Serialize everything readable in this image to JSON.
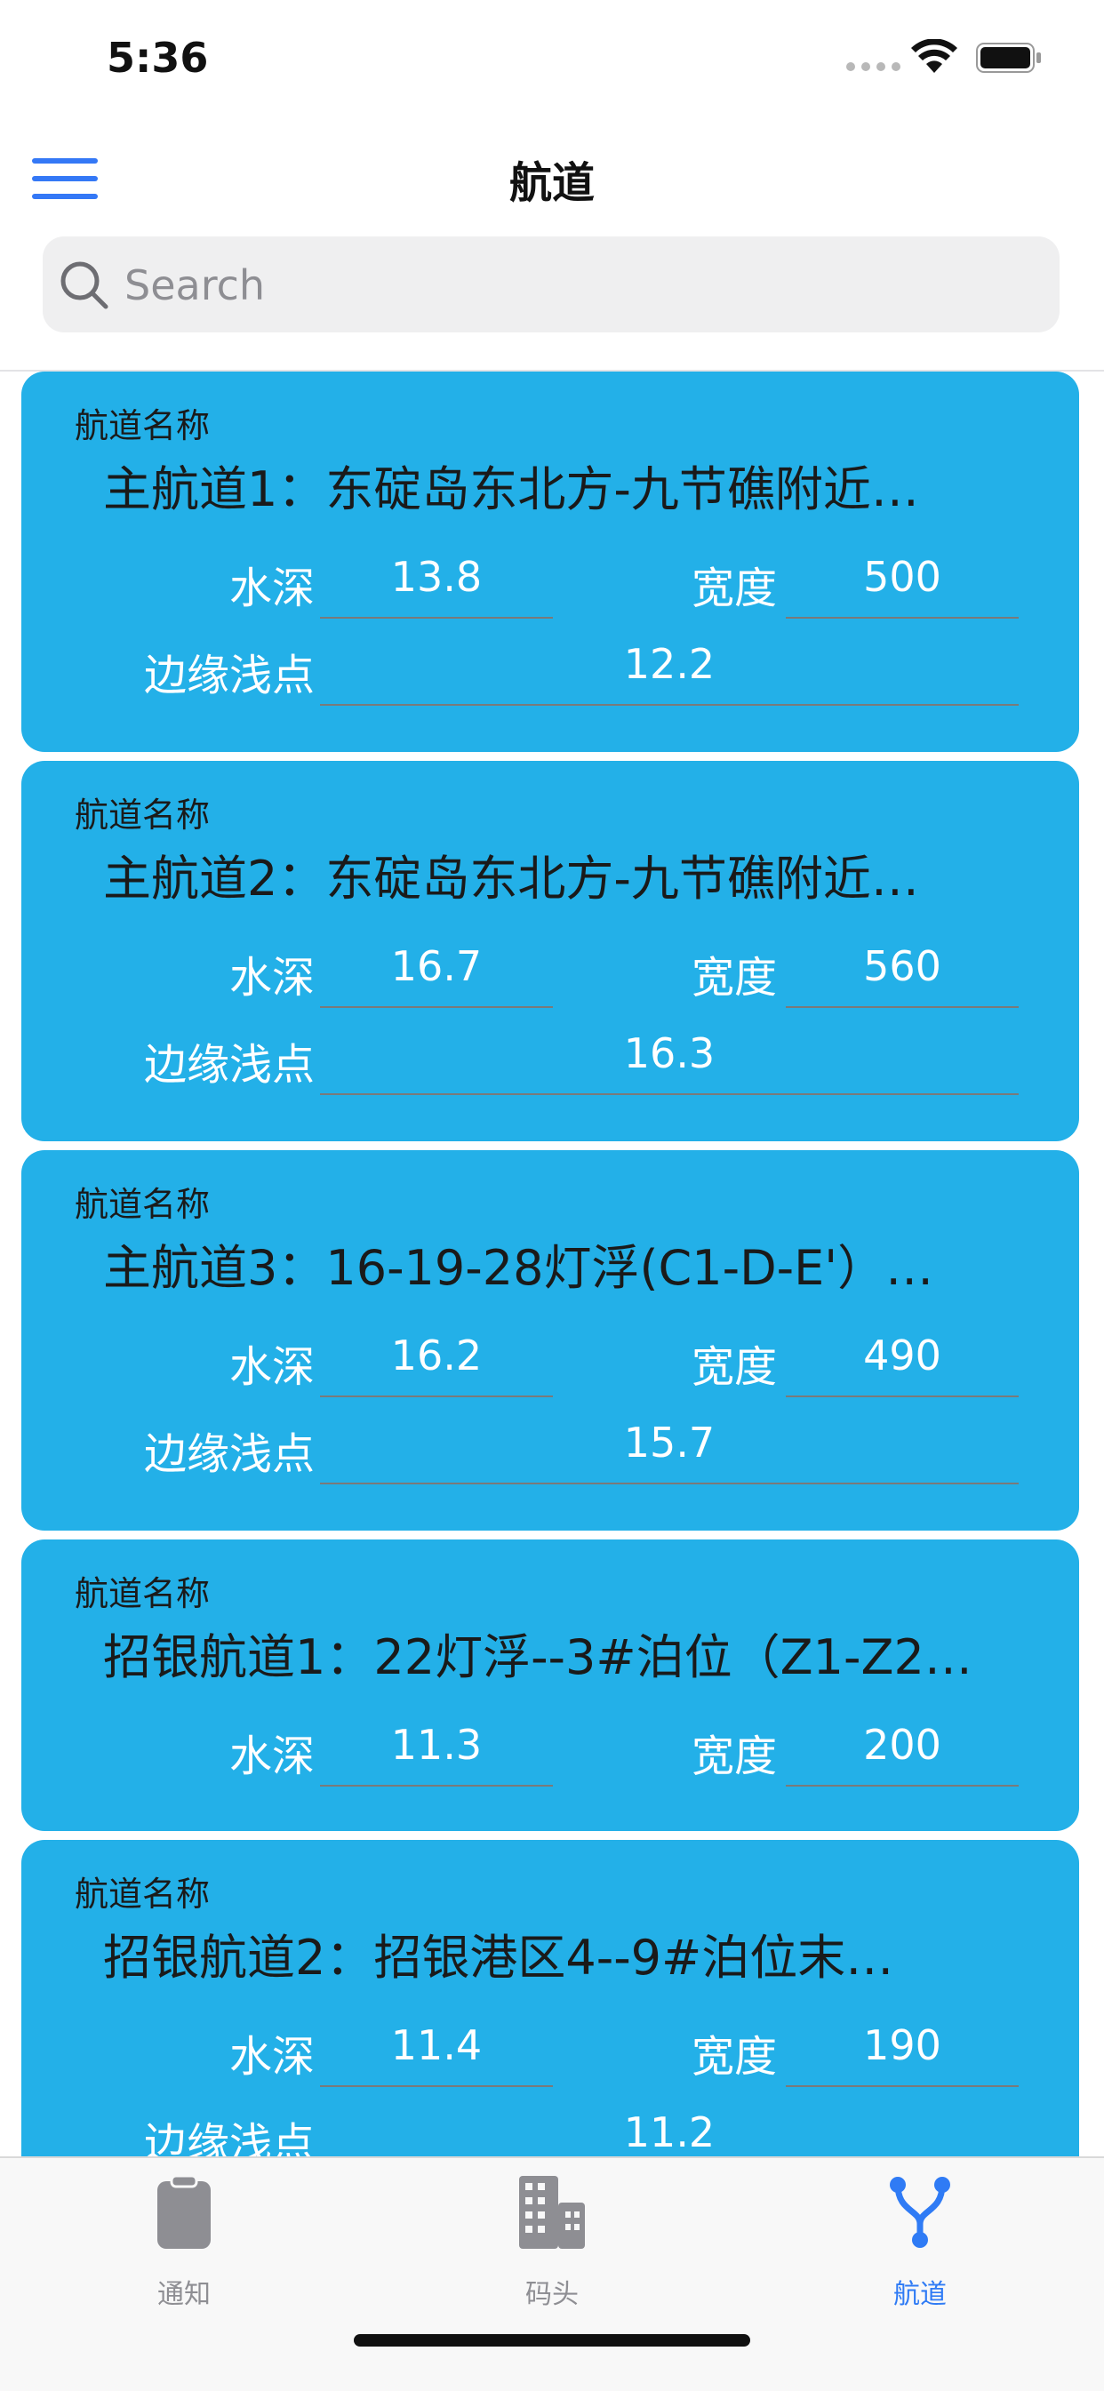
{
  "status": {
    "time": "5:36"
  },
  "nav": {
    "title": "航道"
  },
  "search": {
    "placeholder": "Search"
  },
  "labels": {
    "channel_name": "航道名称",
    "depth": "水深",
    "width": "宽度",
    "edge_shallow": "边缘浅点"
  },
  "channels": [
    {
      "name": "主航道1：东碇岛东北方-九节礁附近…",
      "depth": "13.8",
      "width": "500",
      "edge_shallow": "12.2"
    },
    {
      "name": "主航道2：东碇岛东北方-九节礁附近…",
      "depth": "16.7",
      "width": "560",
      "edge_shallow": "16.3"
    },
    {
      "name": "主航道3：16-19-28灯浮(C1-D-E'）…",
      "depth": "16.2",
      "width": "490",
      "edge_shallow": "15.7"
    },
    {
      "name": "招银航道1：22灯浮--3#泊位（Z1-Z2…",
      "depth": "11.3",
      "width": "200"
    },
    {
      "name": "招银航道2：招银港区4--9#泊位末…",
      "depth": "11.4",
      "width": "190",
      "edge_shallow": "11.2"
    }
  ],
  "tabs": [
    {
      "label": "通知",
      "icon": "clipboard-icon",
      "active": false
    },
    {
      "label": "码头",
      "icon": "building-icon",
      "active": false
    },
    {
      "label": "航道",
      "icon": "channel-fork-icon",
      "active": true
    }
  ],
  "colors": {
    "accent": "#3478f6",
    "card": "#23b0e8",
    "tab_active": "#2f7bf5",
    "tab_inactive": "#8e8e93"
  }
}
